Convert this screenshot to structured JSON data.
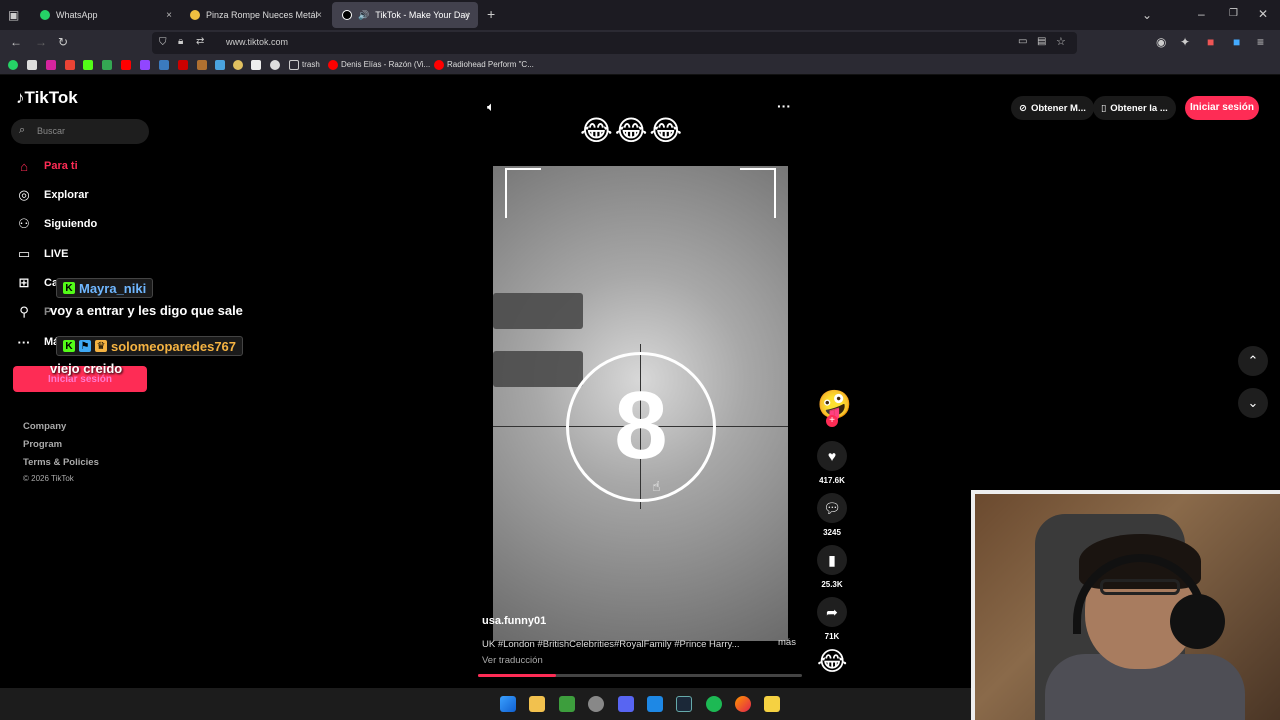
{
  "browser": {
    "tabs": [
      {
        "title": "WhatsApp",
        "active": false
      },
      {
        "title": "Pinza Rompe Nueces Metálica",
        "active": false
      },
      {
        "title": "TikTok - Make Your Day",
        "active": true
      }
    ],
    "url": "www.tiktok.com",
    "bookmarks": [
      "trash",
      "Denis Elías - Razón (Vi...",
      "Radiohead Perform \"C..."
    ],
    "new_tab": "+",
    "close": "×"
  },
  "tiktok": {
    "logo": "TikTok",
    "search_placeholder": "Buscar",
    "nav": [
      {
        "label": "Para ti",
        "icon": "home-icon",
        "active": true
      },
      {
        "label": "Explorar",
        "icon": "compass-icon"
      },
      {
        "label": "Siguiendo",
        "icon": "following-icon"
      },
      {
        "label": "LIVE",
        "icon": "live-icon"
      },
      {
        "label": "Ca",
        "icon": "upload-icon"
      },
      {
        "label": "P",
        "icon": "profile-icon"
      },
      {
        "label": "Má",
        "icon": "more-icon"
      }
    ],
    "login_button": "Iniciar sesión",
    "footer": [
      "Company",
      "Program",
      "Terms & Policies",
      "© 2026 TikTok"
    ],
    "top_buttons": [
      "Obtener M...",
      "Obtener la ...",
      "Iniciar sesión"
    ],
    "video": {
      "top_emoji": "😂😂😂",
      "countdown": "8",
      "author": "usa.funny01",
      "caption": "UK #London #BritishCelebrities#RoyalFamily #Prince Harry...",
      "more": "más",
      "translate": "Ver traducción",
      "progress": 0.24
    },
    "actions": {
      "likes": "417.6K",
      "comments": "3245",
      "saves": "25.3K",
      "shares": "71K"
    }
  },
  "chat": [
    {
      "user": "Mayra_niki",
      "message": "voy a entrar y les digo que sale",
      "color": "#6fb7ff"
    },
    {
      "user": "solomeoparedes767",
      "message": "viejo creido",
      "color": "#f5b342"
    }
  ]
}
